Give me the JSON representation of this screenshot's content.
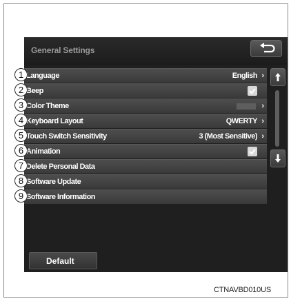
{
  "header": {
    "title": "General Settings"
  },
  "rows": [
    {
      "label": "Language",
      "value": "English",
      "chevron": "›",
      "callout": "1"
    },
    {
      "label": "Beep",
      "checked": true,
      "callout": "2"
    },
    {
      "label": "Color Theme",
      "chevron": "›",
      "callout": "3"
    },
    {
      "label": "Keyboard Layout",
      "value": "QWERTY",
      "chevron": "›",
      "callout": "4"
    },
    {
      "label": "Touch Switch Sensitivity",
      "value": "3 (Most Sensitive)",
      "chevron": "›",
      "callout": "5"
    },
    {
      "label": "Animation",
      "checked": true,
      "callout": "6"
    },
    {
      "label": "Delete Personal Data",
      "callout": "7"
    },
    {
      "label": "Software Update",
      "callout": "8"
    },
    {
      "label": "Software Information",
      "callout": "9"
    }
  ],
  "buttons": {
    "default_label": "Default"
  },
  "footnote": "CTNAVBD010US",
  "icons": {
    "back": "back-arrow-icon",
    "scroll_up": "arrow-up-icon",
    "scroll_down": "arrow-down-icon",
    "check": "checkmark-icon"
  },
  "colors": {
    "screen_bg": "#1f1f1f",
    "row_bg": "#444444",
    "text": "#ffffff"
  }
}
